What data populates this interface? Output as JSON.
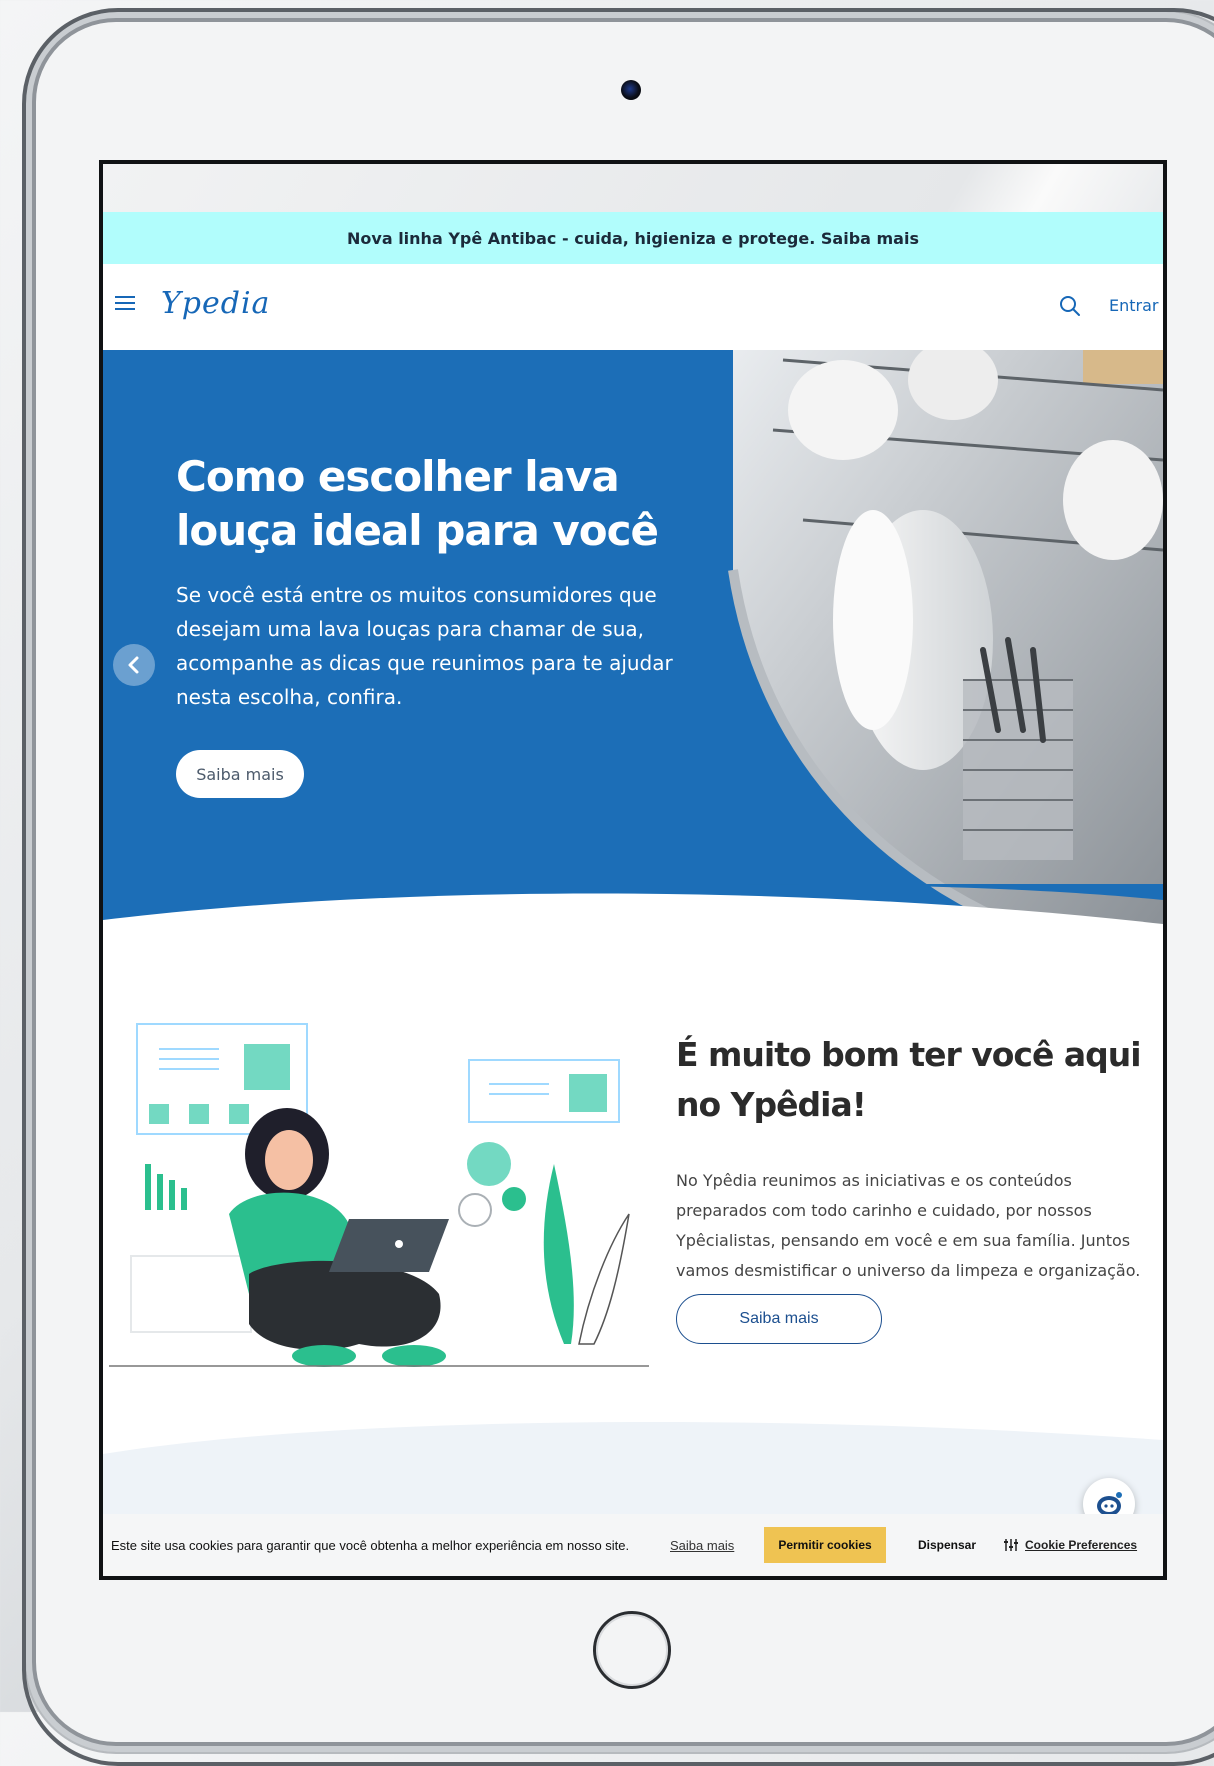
{
  "announcement": {
    "text": "Nova linha Ypê Antibac - cuida, higieniza e protege. Saiba mais"
  },
  "header": {
    "logo": "Ypedia",
    "login_label": "Entrar"
  },
  "hero": {
    "title": "Como escolher lava louça ideal para você",
    "description": "Se você está entre os muitos consumidores que desejam uma lava louças para chamar de sua, acompanhe as dicas que reunimos para te ajudar nesta escolha, confira.",
    "button_label": "Saiba mais"
  },
  "welcome": {
    "title": "É muito bom ter você aqui no Ypêdia!",
    "text": "No Ypêdia reunimos as iniciativas e os conteúdos preparados com todo carinho e cuidado, por nossos Ypêcialistas, pensando em você e em sua família. Juntos vamos desmistificar o universo da limpeza e organização.",
    "button_label": "Saiba mais"
  },
  "cookie": {
    "text": "Este site usa cookies para garantir que você obtenha a melhor experiência em nosso site.",
    "learn_more": "Saiba mais",
    "allow": "Permitir cookies",
    "dismiss": "Dispensar",
    "preferences": "Cookie Preferences"
  },
  "colors": {
    "brand_blue": "#1c6eb7",
    "announce_bg": "#b1fdfc",
    "cookie_allow": "#efc352",
    "illustration_green": "#2bbf8e"
  },
  "icons": [
    "menu-icon",
    "search-icon",
    "chevron-left-icon",
    "chat-bot-icon",
    "sliders-icon"
  ]
}
